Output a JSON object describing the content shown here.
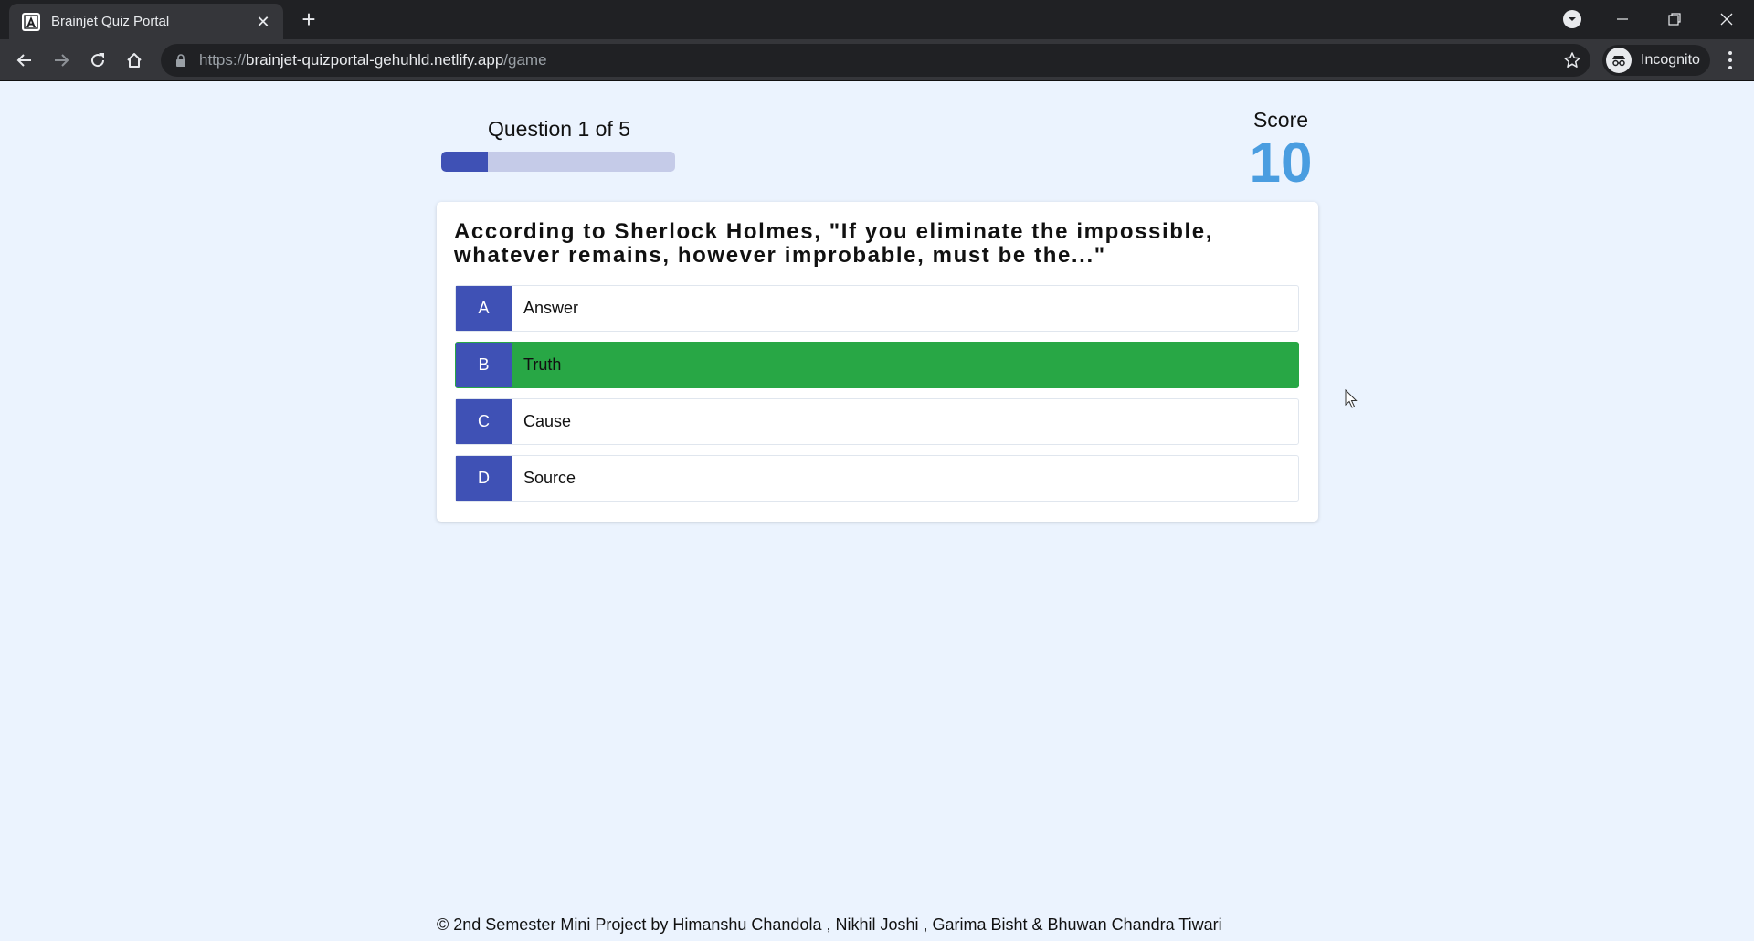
{
  "browser": {
    "tab_title": "Brainjet Quiz Portal",
    "url_prefix": "https://",
    "url_host": "brainjet-quizportal-gehuhld.netlify.app",
    "url_path": "/game",
    "profile_label": "Incognito",
    "icons": [
      "back-icon",
      "forward-icon",
      "reload-icon",
      "home-icon",
      "lock-icon",
      "star-icon",
      "incognito-icon",
      "menu-icon"
    ]
  },
  "hud": {
    "progress_text": "Question 1 of 5",
    "progress_fraction": 0.2,
    "score_label": "Score",
    "score_value": "10"
  },
  "question": {
    "text": "According to Sherlock Holmes, \"If you eliminate the impossible, whatever remains, however improbable, must be the...\"",
    "choices": [
      {
        "prefix": "A",
        "text": "Answer",
        "state": "default"
      },
      {
        "prefix": "B",
        "text": "Truth",
        "state": "correct"
      },
      {
        "prefix": "C",
        "text": "Cause",
        "state": "default"
      },
      {
        "prefix": "D",
        "text": "Source",
        "state": "default"
      }
    ]
  },
  "colors": {
    "accent": "#3f51b5",
    "correct": "#28a745",
    "score": "#4a9de0",
    "background": "#ebf3fe"
  },
  "footer": {
    "text": "© 2nd Semester Mini Project by Himanshu Chandola , Nikhil Joshi , Garima Bisht & Bhuwan Chandra Tiwari"
  }
}
